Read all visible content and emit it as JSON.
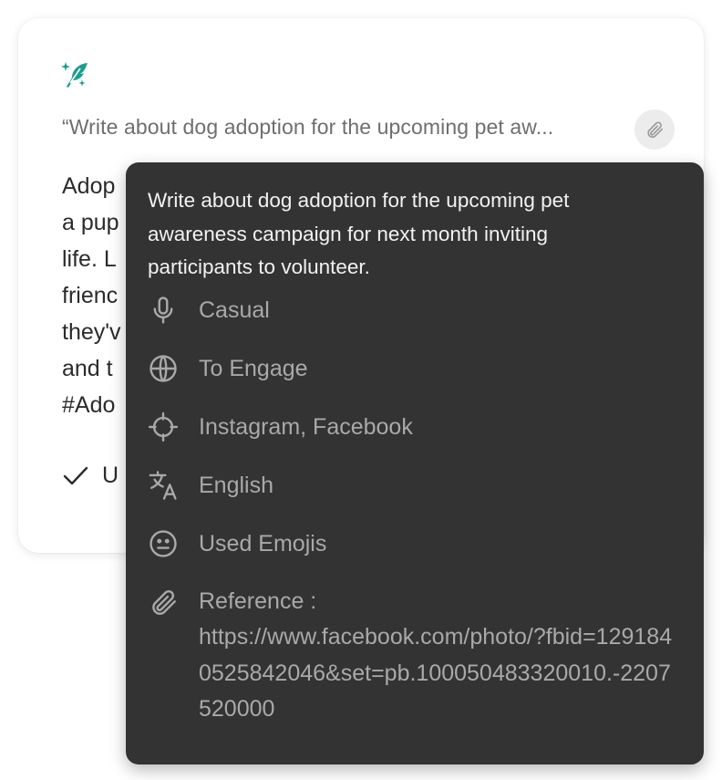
{
  "card": {
    "prompt_text": "“Write about dog adoption for the upcoming pet aw...",
    "body_lines": [
      "Adop",
      "a pup",
      "life. L",
      "frienc",
      "they'v",
      "and t",
      "#Ado"
    ],
    "used_label": "U",
    "icons": {
      "logo": "sparkle-quill-icon",
      "attach": "paperclip-icon",
      "check": "check-icon"
    },
    "colors": {
      "accent": "#1a9e8f"
    }
  },
  "tooltip": {
    "title": "Write about dog adoption for the upcoming pet awareness campaign for next month inviting participants to volunteer.",
    "details": [
      {
        "icon": "microphone-icon",
        "label": "Casual"
      },
      {
        "icon": "globe-icon",
        "label": "To Engage"
      },
      {
        "icon": "crosshair-icon",
        "label": "Instagram, Facebook"
      },
      {
        "icon": "translate-icon",
        "label": "English"
      },
      {
        "icon": "smiley-icon",
        "label": "Used Emojis"
      },
      {
        "icon": "paperclip-icon",
        "label_prefix": "Reference :",
        "label": "https://www.facebook.com/photo/?fbid=1291840525842046&set=pb.100050483320010.-2207520000"
      }
    ]
  }
}
